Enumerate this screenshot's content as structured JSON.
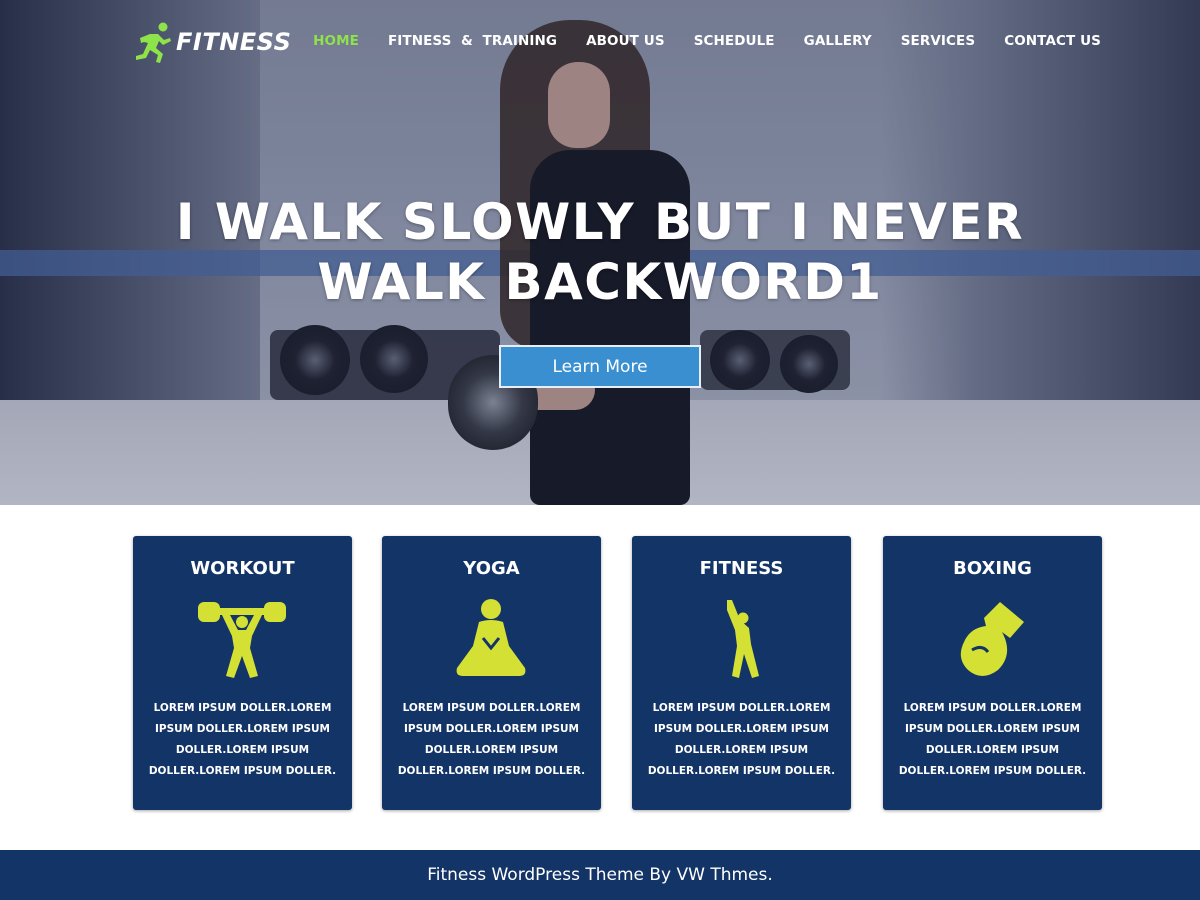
{
  "brand": {
    "name": "FITNESS",
    "accent_color": "#8ee24a",
    "logo_icon": "running-man-icon"
  },
  "nav": {
    "items": [
      {
        "label": "HOME",
        "active": true
      },
      {
        "label": "FITNESS  &  TRAINING",
        "active": false
      },
      {
        "label": "ABOUT US",
        "active": false
      },
      {
        "label": "SCHEDULE",
        "active": false
      },
      {
        "label": "GALLERY",
        "active": false
      },
      {
        "label": "SERVICES",
        "active": false
      },
      {
        "label": "CONTACT US",
        "active": false
      }
    ]
  },
  "hero": {
    "headline_line1": "I WALK SLOWLY BUT I NEVER",
    "headline_line2": "WALK BACKWORD1",
    "cta_label": "Learn More",
    "cta_color": "#3a8fd1"
  },
  "cards": [
    {
      "title": "WORKOUT",
      "icon": "weightlifter-icon",
      "text": "LOREM IPSUM DOLLER.LOREM IPSUM DOLLER.LOREM IPSUM DOLLER.LOREM IPSUM DOLLER.LOREM IPSUM DOLLER."
    },
    {
      "title": "YOGA",
      "icon": "meditation-icon",
      "text": "LOREM IPSUM DOLLER.LOREM IPSUM DOLLER.LOREM IPSUM DOLLER.LOREM IPSUM DOLLER.LOREM IPSUM DOLLER."
    },
    {
      "title": "FITNESS",
      "icon": "stretching-icon",
      "text": "LOREM IPSUM DOLLER.LOREM IPSUM DOLLER.LOREM IPSUM DOLLER.LOREM IPSUM DOLLER.LOREM IPSUM DOLLER."
    },
    {
      "title": "BOXING",
      "icon": "boxing-glove-icon",
      "text": "LOREM IPSUM DOLLER.LOREM IPSUM DOLLER.LOREM IPSUM DOLLER.LOREM IPSUM DOLLER.LOREM IPSUM DOLLER."
    }
  ],
  "card_color": "#133467",
  "icon_color": "#d4e034",
  "footer": {
    "text": "Fitness WordPress Theme By VW Thmes."
  }
}
